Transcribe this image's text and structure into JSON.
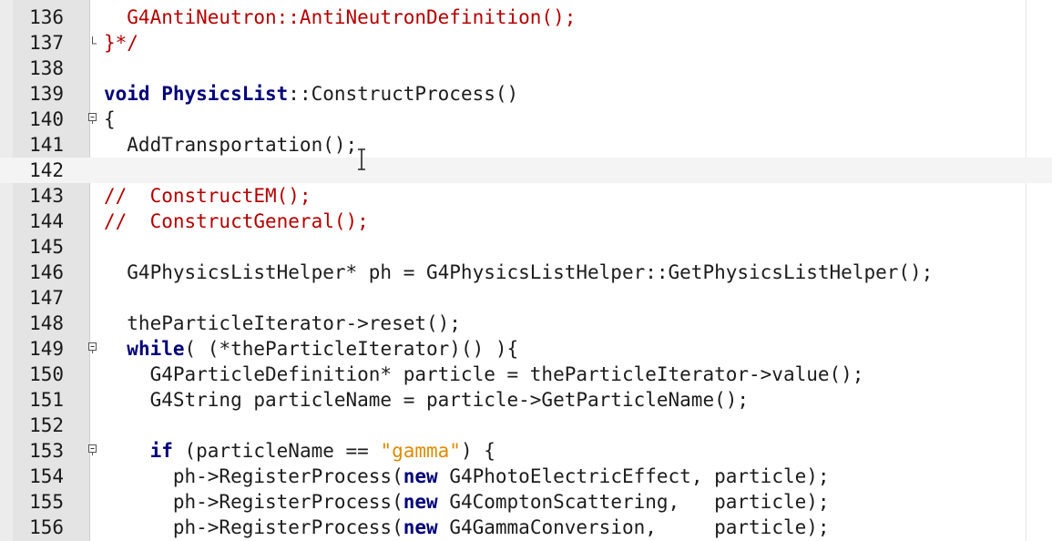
{
  "editor": {
    "current_line": "142",
    "lines": [
      {
        "num": "136",
        "segments": [
          {
            "t": "  G4AntiNeutron::AntiNeutronDefinition();",
            "c": "red"
          }
        ]
      },
      {
        "num": "137",
        "segments": [
          {
            "t": "}*/",
            "c": "red"
          }
        ]
      },
      {
        "num": "138",
        "segments": []
      },
      {
        "num": "139",
        "segments": [
          {
            "t": "void ",
            "c": "kw"
          },
          {
            "t": "PhysicsList",
            "c": "fn"
          },
          {
            "t": "::ConstructProcess()",
            "c": ""
          }
        ]
      },
      {
        "num": "140",
        "segments": [
          {
            "t": "{",
            "c": ""
          }
        ]
      },
      {
        "num": "141",
        "segments": [
          {
            "t": "  AddTransportation();",
            "c": ""
          }
        ]
      },
      {
        "num": "142",
        "segments": []
      },
      {
        "num": "143",
        "segments": [
          {
            "t": "//  ConstructEM();",
            "c": "red"
          }
        ]
      },
      {
        "num": "144",
        "segments": [
          {
            "t": "//  ConstructGeneral();",
            "c": "red"
          }
        ]
      },
      {
        "num": "145",
        "segments": []
      },
      {
        "num": "146",
        "segments": [
          {
            "t": "  G4PhysicsListHelper* ph = G4PhysicsListHelper::GetPhysicsListHelper();",
            "c": ""
          }
        ]
      },
      {
        "num": "147",
        "segments": []
      },
      {
        "num": "148",
        "segments": [
          {
            "t": "  theParticleIterator->reset();",
            "c": ""
          }
        ]
      },
      {
        "num": "149",
        "segments": [
          {
            "t": "  ",
            "c": ""
          },
          {
            "t": "while",
            "c": "kw"
          },
          {
            "t": "( (*theParticleIterator)() ){",
            "c": ""
          }
        ]
      },
      {
        "num": "150",
        "segments": [
          {
            "t": "    G4ParticleDefinition* particle = theParticleIterator->value();",
            "c": ""
          }
        ]
      },
      {
        "num": "151",
        "segments": [
          {
            "t": "    G4String particleName = particle->GetParticleName();",
            "c": ""
          }
        ]
      },
      {
        "num": "152",
        "segments": []
      },
      {
        "num": "153",
        "segments": [
          {
            "t": "    ",
            "c": ""
          },
          {
            "t": "if",
            "c": "kw"
          },
          {
            "t": " (particleName == ",
            "c": ""
          },
          {
            "t": "\"gamma\"",
            "c": "str"
          },
          {
            "t": ") {",
            "c": ""
          }
        ]
      },
      {
        "num": "154",
        "segments": [
          {
            "t": "      ph->RegisterProcess(",
            "c": ""
          },
          {
            "t": "new",
            "c": "kw"
          },
          {
            "t": " G4PhotoElectricEffect, particle);",
            "c": ""
          }
        ]
      },
      {
        "num": "155",
        "segments": [
          {
            "t": "      ph->RegisterProcess(",
            "c": ""
          },
          {
            "t": "new",
            "c": "kw"
          },
          {
            "t": " G4ComptonScattering,   particle);",
            "c": ""
          }
        ]
      },
      {
        "num": "156",
        "segments": [
          {
            "t": "      ph->RegisterProcess(",
            "c": ""
          },
          {
            "t": "new",
            "c": "kw"
          },
          {
            "t": " G4GammaConversion,     particle);",
            "c": ""
          }
        ]
      }
    ]
  },
  "colors": {
    "keyword": "#00007a",
    "comment": "#b50000",
    "string": "#e08a00",
    "gutter": "#e4e4e4"
  }
}
